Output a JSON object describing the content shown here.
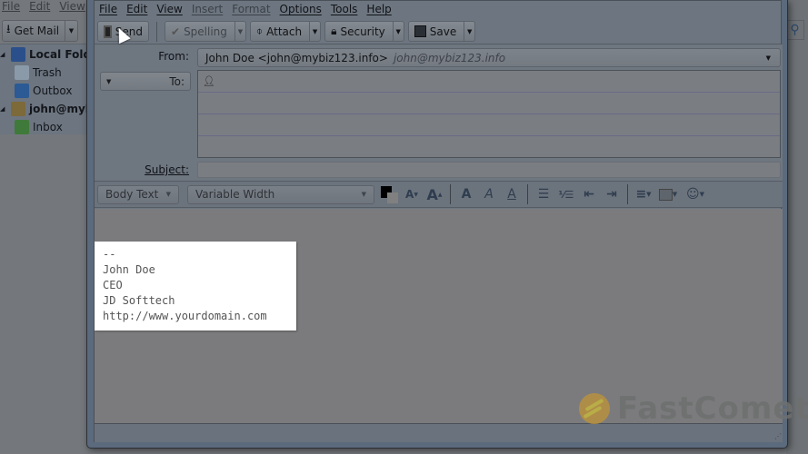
{
  "background_app": {
    "menu": [
      "File",
      "Edit",
      "View"
    ],
    "get_mail_label": "Get Mail",
    "folders": [
      {
        "label": "Local Folders",
        "icon": "computer-icon",
        "bold": true
      },
      {
        "label": "Trash",
        "icon": "trash-icon",
        "bold": false
      },
      {
        "label": "Outbox",
        "icon": "outbox-icon",
        "bold": false
      },
      {
        "label": "john@mybiz",
        "icon": "account-icon",
        "bold": true
      },
      {
        "label": "Inbox",
        "icon": "inbox-icon",
        "bold": false
      }
    ]
  },
  "compose": {
    "menu": [
      "File",
      "Edit",
      "View",
      "Insert",
      "Format",
      "Options",
      "Tools",
      "Help"
    ],
    "toolbar": {
      "send": "Send",
      "spelling": "Spelling",
      "attach": "Attach",
      "security": "Security",
      "save": "Save"
    },
    "header": {
      "from_label": "From:",
      "from_value": "John Doe <john@mybiz123.info>",
      "from_identity": "john@mybiz123.info",
      "to_label": "To:",
      "subject_label": "Subject:",
      "subject_value": ""
    },
    "format": {
      "paragraph_style": "Body Text",
      "font": "Variable Width",
      "text_color": "#000000",
      "icons": [
        "smaller-text-icon",
        "larger-text-icon",
        "bold-icon",
        "italic-icon",
        "underline-icon",
        "bullet-list-icon",
        "numbered-list-icon",
        "outdent-icon",
        "indent-icon",
        "align-icon",
        "insert-icon",
        "smiley-icon"
      ]
    },
    "signature": [
      "--",
      "John Doe",
      "CEO",
      "JD Softtech",
      "http://www.yourdomain.com"
    ]
  },
  "watermark": "FastComet"
}
